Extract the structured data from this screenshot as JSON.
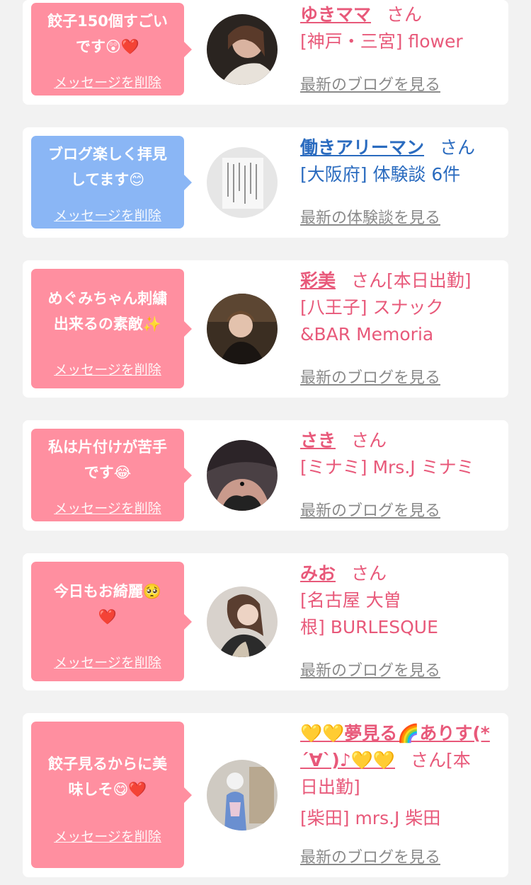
{
  "colors": {
    "pink_bubble": "#ff8fa0",
    "blue_bubble": "#8ab6f5",
    "name_pink": "#e8597a",
    "name_blue": "#2a6bbf",
    "link_gray": "#8a8a8a"
  },
  "delete_label": "メッセージを削除",
  "cards": [
    {
      "bubble_color": "pink",
      "message_line1": "餃子150個すごい",
      "message_line2": "です😲❤️",
      "name": "ゆきママ",
      "honorific": "さん",
      "location": "[神戸・三宮] flower",
      "link": "最新のブログを見る",
      "avatar_icon": "woman-photo-icon"
    },
    {
      "bubble_color": "blue",
      "message_line1": "ブログ楽しく拝見",
      "message_line2": "してます😊",
      "name": "働きアリーマン",
      "honorific": "さん",
      "location": "[大阪府] 体験談 6件",
      "link": "最新の体験談を見る",
      "avatar_icon": "handwritten-note-icon"
    },
    {
      "bubble_color": "pink",
      "message_line1": "めぐみちゃん刺繍",
      "message_line2": "出来るの素敵✨",
      "name": "彩美",
      "honorific": "さん[本日出勤]",
      "location_line1": "[八王子] スナック",
      "location_line2": "&BAR Memoria",
      "link": "最新のブログを見る",
      "avatar_icon": "woman-photo-icon"
    },
    {
      "bubble_color": "pink",
      "message_line1": "私は片付けが苦手",
      "message_line2": "です😂",
      "name": "さき",
      "honorific": "さん",
      "location": "[ミナミ] Mrs.J ミナミ",
      "link": "最新のブログを見る",
      "avatar_icon": "woman-photo-icon"
    },
    {
      "bubble_color": "pink",
      "message_line1": "今日もお綺麗🥺",
      "message_line2": "❤️",
      "name": "みお",
      "honorific": "さん",
      "location_line1": "[名古屋 大曽",
      "location_line2": "根] BURLESQUE",
      "link": "最新のブログを見る",
      "avatar_icon": "woman-photo-icon"
    },
    {
      "bubble_color": "pink",
      "message_line1": "餃子見るからに美",
      "message_line2": "味しそ😋❤️",
      "name_line1": "💛💛夢見る🌈ありす(*",
      "name_line2": "´∀`)♪💛💛",
      "honorific": "さん[本",
      "honorific_line2": "日出勤]",
      "location": "[柴田] mrs.J 柴田",
      "link": "最新のブログを見る",
      "avatar_icon": "woman-kimono-photo-icon"
    }
  ]
}
